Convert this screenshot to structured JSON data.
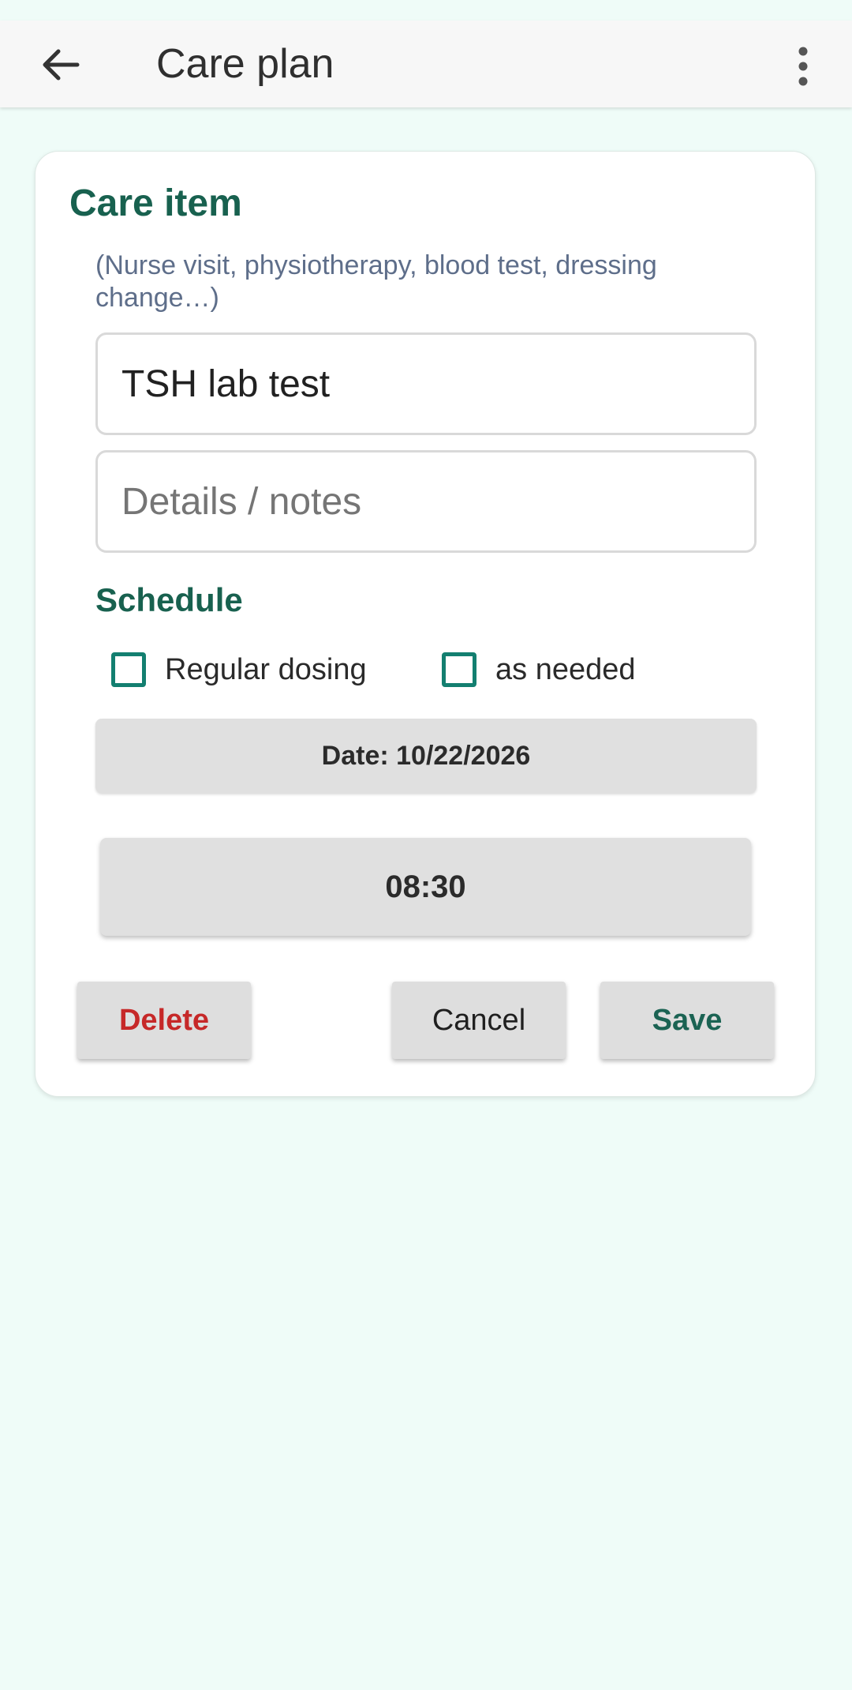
{
  "app_bar": {
    "title": "Care plan",
    "back_icon": "arrow-back-icon",
    "more_icon": "more-vert-icon"
  },
  "card": {
    "title": "Care item",
    "hint": "(Nurse visit, physiotherapy, blood test, dressing change…)",
    "item_field": {
      "value": "TSH lab test"
    },
    "notes_field": {
      "value": "",
      "placeholder": "Details / notes"
    },
    "schedule": {
      "title": "Schedule",
      "options": [
        {
          "label": "Regular dosing",
          "checked": false
        },
        {
          "label": "as needed",
          "checked": false
        }
      ],
      "date_label": "Date: 10/22/2026",
      "time_label": "08:30"
    },
    "actions": {
      "delete_label": "Delete",
      "cancel_label": "Cancel",
      "save_label": "Save"
    }
  },
  "colors": {
    "background": "#effcf8",
    "accent": "#18614f",
    "checkbox": "#137f70",
    "delete": "#c62828",
    "hint": "#5e6e8a"
  }
}
